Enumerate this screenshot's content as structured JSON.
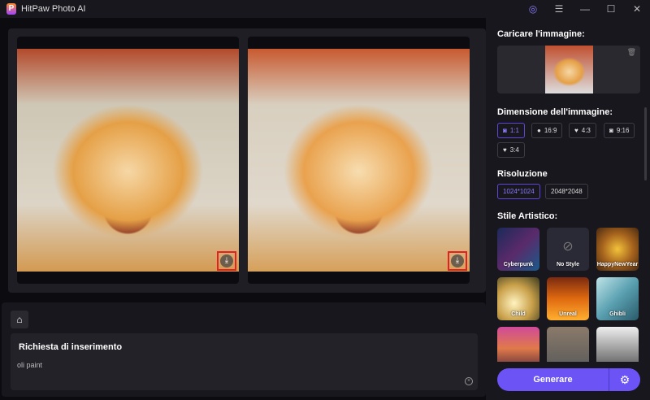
{
  "app": {
    "title": "HitPaw Photo AI",
    "logo": "P"
  },
  "titlebar": {
    "icons": [
      "user-icon",
      "menu-icon",
      "minimize-icon",
      "maximize-icon",
      "close-icon"
    ]
  },
  "prompt": {
    "home_icon": "home-icon",
    "label": "Richiesta di inserimento",
    "value": "oli paint"
  },
  "sidebar": {
    "upload_label": "Caricare l'immagine:",
    "size_label": "Dimensione dell'immagine:",
    "sizes": [
      {
        "label": "1:1",
        "icon": "instagram",
        "selected": true
      },
      {
        "label": "16:9",
        "icon": "facebook"
      },
      {
        "label": "4:3",
        "icon": "twitter"
      },
      {
        "label": "9:16",
        "icon": "instagram"
      },
      {
        "label": "3:4",
        "icon": "twitter"
      }
    ],
    "resolution_label": "Risoluzione",
    "resolutions": [
      {
        "label": "1024*1024",
        "selected": true
      },
      {
        "label": "2048*2048"
      }
    ],
    "style_label": "Stile Artistico:",
    "styles": [
      {
        "label": "Cyberpunk"
      },
      {
        "label": "No Style"
      },
      {
        "label": "HappyNewYear"
      },
      {
        "label": "Child"
      },
      {
        "label": "Unreal"
      },
      {
        "label": "Ghibli"
      },
      {
        "label": ""
      },
      {
        "label": ""
      },
      {
        "label": ""
      }
    ],
    "generate_label": "Generare"
  },
  "colors": {
    "accent": "#6b53f5",
    "highlight": "#e52020"
  }
}
